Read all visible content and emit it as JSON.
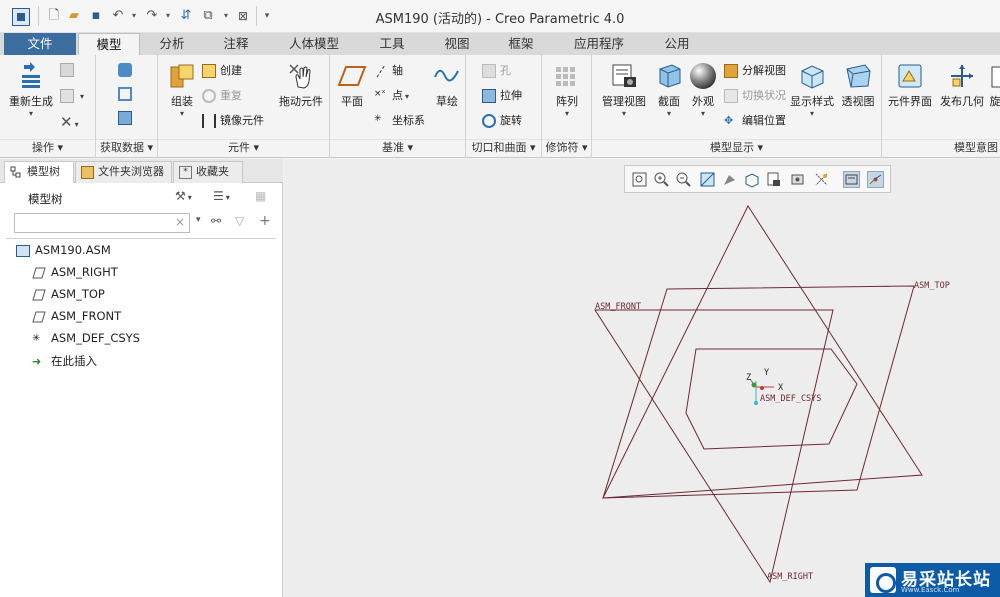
{
  "window": {
    "title": "ASM190 (活动的) - Creo Parametric 4.0"
  },
  "quick_access": {
    "icons": [
      "app-icon",
      "new-icon",
      "open-icon",
      "save-icon",
      "undo-icon",
      "redo-icon",
      "regenerate-icon",
      "windows-icon",
      "close-window-icon",
      "customize-icon"
    ]
  },
  "menu": {
    "tabs": [
      "文件",
      "模型",
      "分析",
      "注释",
      "人体模型",
      "工具",
      "视图",
      "框架",
      "应用程序",
      "公用"
    ],
    "active": "模型"
  },
  "ribbon": {
    "groups": {
      "operations": {
        "label": "操作",
        "regenerate": "重新生成"
      },
      "get_data": {
        "label": "获取数据"
      },
      "components": {
        "label": "元件",
        "assemble": "组装",
        "create": "创建",
        "repeat": "重复",
        "mirror": "镜像元件",
        "drag": "拖动元件"
      },
      "datum": {
        "label": "基准",
        "plane": "平面",
        "axis": "轴",
        "point": "点",
        "csys": "坐标系",
        "sketch": "草绘"
      },
      "cut_surface": {
        "label": "切口和曲面",
        "hole": "孔",
        "extrude": "拉伸",
        "revolve": "旋转"
      },
      "modifiers": {
        "label": "修饰符",
        "pattern": "阵列"
      },
      "model_display": {
        "label": "模型显示",
        "manage_views": "管理视图",
        "section": "截面",
        "appearance": "外观",
        "explode": "分解视图",
        "toggle_status": "切换状况",
        "edit_position": "编辑位置",
        "display_style": "显示样式",
        "perspective": "透视图"
      },
      "model_intent": {
        "label": "模型意图",
        "component_interface": "元件界面",
        "publish_geometry": "发布几何",
        "next_partial": "旋"
      }
    }
  },
  "left_panel": {
    "tabs": [
      "模型树",
      "文件夹浏览器",
      "收藏夹"
    ],
    "tree_title": "模型树",
    "search": {
      "value": "",
      "clear": "×"
    },
    "tree": {
      "root": "ASM190.ASM",
      "items": [
        "ASM_RIGHT",
        "ASM_TOP",
        "ASM_FRONT",
        "ASM_DEF_CSYS",
        "在此插入"
      ]
    }
  },
  "canvas": {
    "datum_labels": {
      "front": "ASM_FRONT",
      "top": "ASM_TOP",
      "right": "ASM_RIGHT",
      "csys": "ASM_DEF_CSYS"
    },
    "axes": {
      "x": "X",
      "y": "Y",
      "z": "Z"
    },
    "plane_color": "#6b2a35",
    "background": "#ededed"
  },
  "watermark": {
    "text": "易采站长站",
    "url": "Www.Easck.Com"
  }
}
